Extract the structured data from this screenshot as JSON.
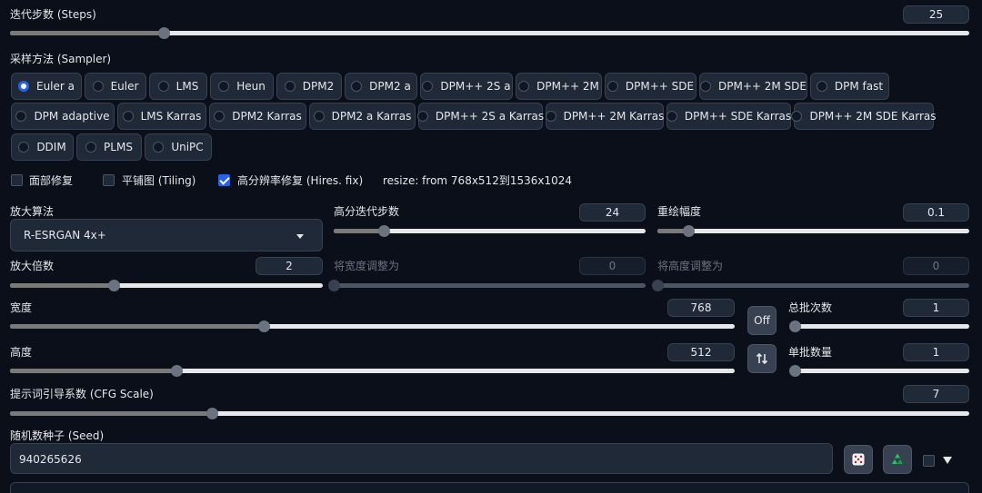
{
  "steps": {
    "label": "迭代步数 (Steps)",
    "value": "25",
    "fraction": 0.16
  },
  "sampler": {
    "label": "采样方法 (Sampler)",
    "options": [
      "Euler a",
      "Euler",
      "LMS",
      "Heun",
      "DPM2",
      "DPM2 a",
      "DPM++ 2S a",
      "DPM++ 2M",
      "DPM++ SDE",
      "DPM++ 2M SDE",
      "DPM fast",
      "DPM adaptive",
      "LMS Karras",
      "DPM2 Karras",
      "DPM2 a Karras",
      "DPM++ 2S a Karras",
      "DPM++ 2M Karras",
      "DPM++ SDE Karras",
      "DPM++ 2M SDE Karras",
      "DDIM",
      "PLMS",
      "UniPC"
    ],
    "selected": "Euler a"
  },
  "checks": {
    "face_restore": "面部修复",
    "tiling": "平铺图 (Tiling)",
    "hires_fix": "高分辨率修复 (Hires. fix)",
    "resize_info": "resize: from 768x512到1536x1024"
  },
  "upscaler": {
    "label": "放大算法",
    "value": "R-ESRGAN 4x+"
  },
  "hires_steps": {
    "label": "高分迭代步数",
    "value": "24",
    "fraction": 0.16
  },
  "denoise": {
    "label": "重绘幅度",
    "value": "0.1",
    "fraction": 0.1
  },
  "upscale_by": {
    "label": "放大倍数",
    "value": "2",
    "fraction": 0.33
  },
  "resize_width": {
    "label": "将宽度调整为",
    "value": "0",
    "fraction": 0
  },
  "resize_height": {
    "label": "将高度调整为",
    "value": "0",
    "fraction": 0
  },
  "width": {
    "label": "宽度",
    "value": "768",
    "fraction": 0.35
  },
  "height": {
    "label": "高度",
    "value": "512",
    "fraction": 0.23
  },
  "batch_count": {
    "label": "总批次数",
    "value": "1",
    "fraction": 0
  },
  "batch_size": {
    "label": "单批数量",
    "value": "1",
    "fraction": 0
  },
  "off_label": "Off",
  "cfg": {
    "label": "提示词引导系数 (CFG Scale)",
    "value": "7",
    "fraction": 0.21
  },
  "seed": {
    "label": "随机数种子 (Seed)",
    "value": "940265626"
  },
  "icons": {
    "swap": "swap-vertical-icon",
    "dice": "dice-icon",
    "recycle": "recycle-icon",
    "extra": "triangle-down-icon"
  },
  "colors": {
    "accent": "#2563eb",
    "recycle": "#22c55e",
    "background": "#0b0f19"
  }
}
